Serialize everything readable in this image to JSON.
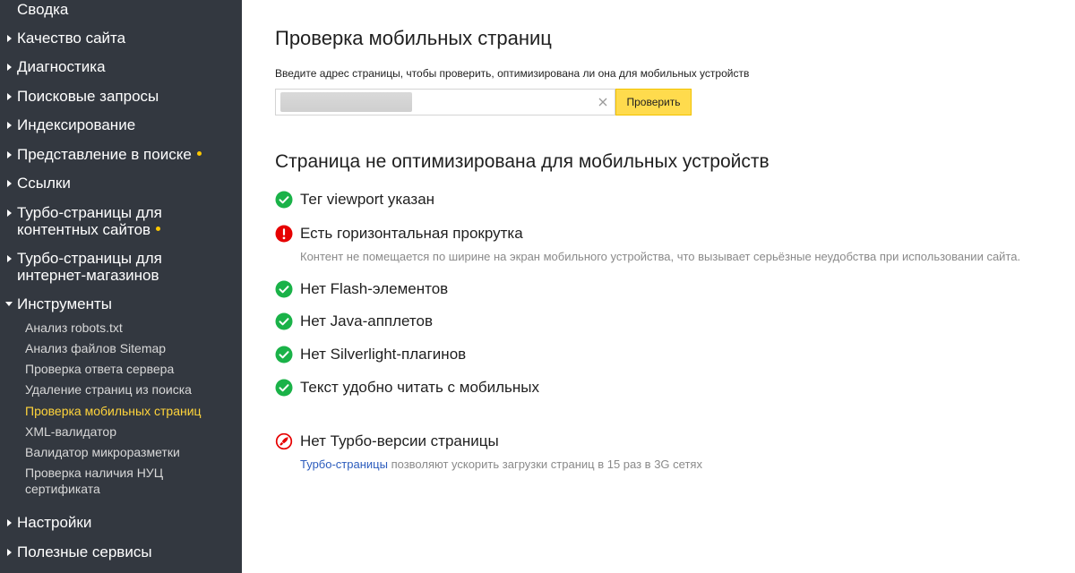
{
  "colors": {
    "sidebar_bg": "#333840",
    "accent_yellow": "#ffdb4d",
    "active_link": "#ffd43b",
    "ok_green": "#1ab248",
    "error_red": "#e60000",
    "link_blue": "#2c5cbd"
  },
  "sidebar": {
    "items": [
      {
        "label": "Сводка",
        "arrow": "none",
        "dot": false
      },
      {
        "label": "Качество сайта",
        "arrow": "right",
        "dot": false
      },
      {
        "label": "Диагностика",
        "arrow": "right",
        "dot": false
      },
      {
        "label": "Поисковые запросы",
        "arrow": "right",
        "dot": false
      },
      {
        "label": "Индексирование",
        "arrow": "right",
        "dot": false
      },
      {
        "label": "Представление в поиске",
        "arrow": "right",
        "dot": true
      },
      {
        "label": "Ссылки",
        "arrow": "right",
        "dot": false
      },
      {
        "label_line1": "Турбо-страницы для",
        "label_line2": "контентных сайтов",
        "arrow": "right",
        "dot": true
      },
      {
        "label_line1": "Турбо-страницы для",
        "label_line2": "интернет-магазинов",
        "arrow": "right",
        "dot": false
      },
      {
        "label": "Инструменты",
        "arrow": "down",
        "dot": false
      },
      {
        "label": "Настройки",
        "arrow": "right",
        "dot": false
      },
      {
        "label": "Полезные сервисы",
        "arrow": "right",
        "dot": false
      }
    ],
    "tools_subitems": [
      {
        "label": "Анализ robots.txt",
        "active": false
      },
      {
        "label": "Анализ файлов Sitemap",
        "active": false
      },
      {
        "label": "Проверка ответа сервера",
        "active": false
      },
      {
        "label": "Удаление страниц из поиска",
        "active": false
      },
      {
        "label": "Проверка мобильных страниц",
        "active": true
      },
      {
        "label": "XML-валидатор",
        "active": false
      },
      {
        "label": "Валидатор микроразметки",
        "active": false
      },
      {
        "label_line1": "Проверка наличия НУЦ",
        "label_line2": "сертификата",
        "active": false
      }
    ]
  },
  "main": {
    "title": "Проверка мобильных страниц",
    "url_hint": "Введите адрес страницы, чтобы проверить, оптимизирована ли она для мобильных устройств",
    "url_value": "",
    "check_button": "Проверить",
    "result_title": "Страница не оптимизирована для мобильных устройств",
    "checks": [
      {
        "status": "ok",
        "icon": "check-circle-icon",
        "label": "Тег viewport указан"
      },
      {
        "status": "error",
        "icon": "exclamation-circle-icon",
        "label": "Есть горизонтальная прокрутка",
        "description": "Контент не помещается по ширине на экран мобильного устройства, что вызывает серьёзные неудобства при использовании сайта."
      },
      {
        "status": "ok",
        "icon": "check-circle-icon",
        "label": "Нет Flash-элементов"
      },
      {
        "status": "ok",
        "icon": "check-circle-icon",
        "label": "Нет Java-апплетов"
      },
      {
        "status": "ok",
        "icon": "check-circle-icon",
        "label": "Нет Silverlight-плагинов"
      },
      {
        "status": "ok",
        "icon": "check-circle-icon",
        "label": "Текст удобно читать с мобильных"
      }
    ],
    "turbo": {
      "icon": "rocket-icon",
      "label": "Нет Турбо-версии страницы",
      "link_text": "Турбо-страницы",
      "description": " позволяют ускорить загрузки страниц в 15 раз в 3G сетях"
    }
  }
}
